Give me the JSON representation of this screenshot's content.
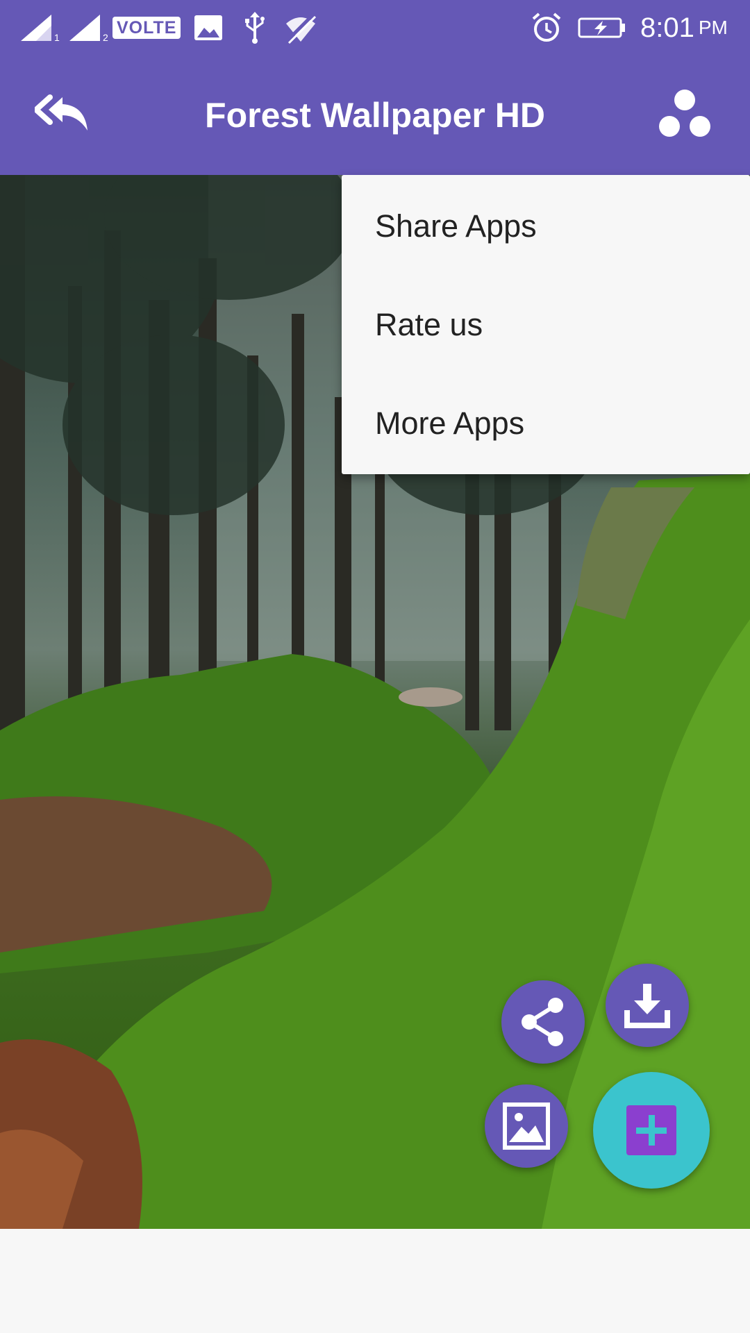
{
  "status_bar": {
    "sim1_label": "1",
    "sim2_label": "2",
    "volte_label": "VOLTE",
    "time": "8:01",
    "ampm": "PM",
    "icons": [
      "signal-icon",
      "signal-icon",
      "volte-badge",
      "image-icon",
      "usb-icon",
      "wifi-off-icon",
      "alarm-icon",
      "battery-charging-icon"
    ]
  },
  "app_bar": {
    "title": "Forest Wallpaper HD",
    "back_icon": "reply-all-icon",
    "overflow_icon": "dots-icon"
  },
  "menu": {
    "items": [
      {
        "label": "Share Apps"
      },
      {
        "label": "Rate us"
      },
      {
        "label": "More Apps"
      }
    ]
  },
  "fabs": {
    "share_icon": "share-icon",
    "download_icon": "download-icon",
    "gallery_icon": "image-icon",
    "main_icon": "plus-icon"
  },
  "colors": {
    "primary": "#6558b6",
    "accent": "#3bc4cd",
    "plus_box": "#8b3fcf",
    "menu_bg": "#f7f7f7"
  }
}
